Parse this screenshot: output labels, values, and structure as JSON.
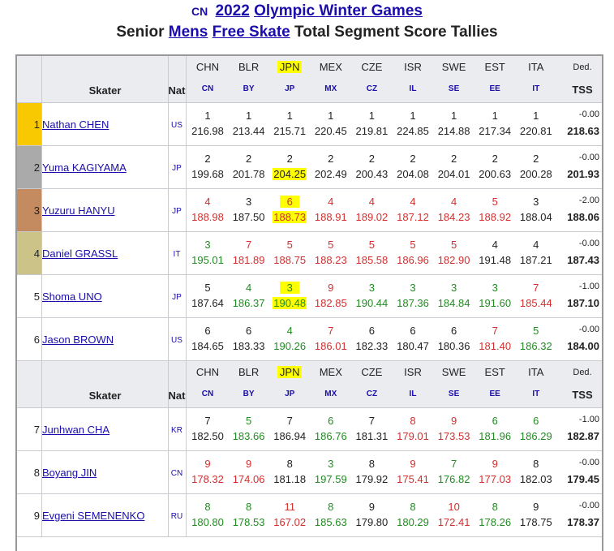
{
  "title": {
    "country_code": "CN",
    "year": "2022",
    "event": "Olympic Winter Games",
    "line2_pre": "Senior",
    "category": "Mens",
    "segment": "Free Skate",
    "line2_post": "Total Segment Score Tallies"
  },
  "header": {
    "skater": "Skater",
    "nat": "Nat",
    "ded": "Ded.",
    "tss": "TSS",
    "judges": [
      {
        "name": "CHN",
        "code": "CN"
      },
      {
        "name": "BLR",
        "code": "BY"
      },
      {
        "name": "JPN",
        "code": "JP"
      },
      {
        "name": "MEX",
        "code": "MX"
      },
      {
        "name": "CZE",
        "code": "CZ"
      },
      {
        "name": "ISR",
        "code": "IL"
      },
      {
        "name": "SWE",
        "code": "SE"
      },
      {
        "name": "EST",
        "code": "EE"
      },
      {
        "name": "ITA",
        "code": "IT"
      }
    ]
  },
  "colors": {
    "gold": "#f8c900",
    "silver": "#aaaaaa",
    "bronze": "#c38b5f",
    "fourth": "#ccc389",
    "green": "#228b22",
    "red": "#d32f2f",
    "highlight": "#ffff00",
    "link": "#1a0dab"
  },
  "rows": [
    {
      "rank": "1",
      "skater": "Nathan CHEN",
      "nat": "US",
      "ded": "-0.00",
      "tss": "218.63",
      "scores": [
        [
          "1",
          "216.98",
          "black"
        ],
        [
          "1",
          "213.44",
          "black"
        ],
        [
          "1",
          "215.71",
          "black"
        ],
        [
          "1",
          "220.45",
          "black"
        ],
        [
          "1",
          "219.81",
          "black"
        ],
        [
          "1",
          "224.85",
          "black"
        ],
        [
          "1",
          "214.88",
          "black"
        ],
        [
          "1",
          "217.34",
          "black"
        ],
        [
          "1",
          "220.81",
          "black"
        ]
      ]
    },
    {
      "rank": "2",
      "skater": "Yuma KAGIYAMA",
      "nat": "JP",
      "ded": "-0.00",
      "tss": "201.93",
      "scores": [
        [
          "2",
          "199.68",
          "black"
        ],
        [
          "2",
          "201.78",
          "black"
        ],
        [
          "2",
          "204.25",
          "black"
        ],
        [
          "2",
          "202.49",
          "black"
        ],
        [
          "2",
          "200.43",
          "black"
        ],
        [
          "2",
          "204.08",
          "black"
        ],
        [
          "2",
          "204.01",
          "black"
        ],
        [
          "2",
          "200.63",
          "black"
        ],
        [
          "2",
          "200.28",
          "black"
        ]
      ]
    },
    {
      "rank": "3",
      "skater": "Yuzuru HANYU",
      "nat": "JP",
      "ded": "-2.00",
      "tss": "188.06",
      "scores": [
        [
          "4",
          "188.98",
          "red"
        ],
        [
          "3",
          "187.50",
          "black"
        ],
        [
          "6",
          "188.73",
          "red"
        ],
        [
          "4",
          "188.91",
          "red"
        ],
        [
          "4",
          "189.02",
          "red"
        ],
        [
          "4",
          "187.12",
          "red"
        ],
        [
          "4",
          "184.23",
          "red"
        ],
        [
          "5",
          "188.92",
          "red"
        ],
        [
          "3",
          "188.04",
          "black"
        ]
      ]
    },
    {
      "rank": "4",
      "skater": "Daniel GRASSL",
      "nat": "IT",
      "ded": "-0.00",
      "tss": "187.43",
      "scores": [
        [
          "3",
          "195.01",
          "green"
        ],
        [
          "7",
          "181.89",
          "red"
        ],
        [
          "5",
          "188.75",
          "red"
        ],
        [
          "5",
          "188.23",
          "red"
        ],
        [
          "5",
          "185.58",
          "red"
        ],
        [
          "5",
          "186.96",
          "red"
        ],
        [
          "5",
          "182.90",
          "red"
        ],
        [
          "4",
          "191.48",
          "black"
        ],
        [
          "4",
          "187.21",
          "black"
        ]
      ]
    },
    {
      "rank": "5",
      "skater": "Shoma UNO",
      "nat": "JP",
      "ded": "-1.00",
      "tss": "187.10",
      "scores": [
        [
          "5",
          "187.64",
          "black"
        ],
        [
          "4",
          "186.37",
          "green"
        ],
        [
          "3",
          "190.48",
          "green"
        ],
        [
          "9",
          "182.85",
          "red"
        ],
        [
          "3",
          "190.44",
          "green"
        ],
        [
          "3",
          "187.36",
          "green"
        ],
        [
          "3",
          "184.84",
          "green"
        ],
        [
          "3",
          "191.60",
          "green"
        ],
        [
          "7",
          "185.44",
          "red"
        ]
      ]
    },
    {
      "rank": "6",
      "skater": "Jason BROWN",
      "nat": "US",
      "ded": "-0.00",
      "tss": "184.00",
      "scores": [
        [
          "6",
          "184.65",
          "black"
        ],
        [
          "6",
          "183.33",
          "black"
        ],
        [
          "4",
          "190.26",
          "green"
        ],
        [
          "7",
          "186.01",
          "red"
        ],
        [
          "6",
          "182.33",
          "black"
        ],
        [
          "6",
          "180.47",
          "black"
        ],
        [
          "6",
          "180.36",
          "black"
        ],
        [
          "7",
          "181.40",
          "red"
        ],
        [
          "5",
          "186.32",
          "green"
        ]
      ]
    },
    {
      "rank": "7",
      "skater": "Junhwan CHA",
      "nat": "KR",
      "ded": "-1.00",
      "tss": "182.87",
      "scores": [
        [
          "7",
          "182.50",
          "black"
        ],
        [
          "5",
          "183.66",
          "green"
        ],
        [
          "7",
          "186.94",
          "black"
        ],
        [
          "6",
          "186.76",
          "green"
        ],
        [
          "7",
          "181.31",
          "black"
        ],
        [
          "8",
          "179.01",
          "red"
        ],
        [
          "9",
          "173.53",
          "red"
        ],
        [
          "6",
          "181.96",
          "green"
        ],
        [
          "6",
          "186.29",
          "green"
        ]
      ]
    },
    {
      "rank": "8",
      "skater": "Boyang JIN",
      "nat": "CN",
      "ded": "-0.00",
      "tss": "179.45",
      "scores": [
        [
          "9",
          "178.32",
          "red"
        ],
        [
          "9",
          "174.06",
          "red"
        ],
        [
          "8",
          "181.18",
          "black"
        ],
        [
          "3",
          "197.59",
          "green"
        ],
        [
          "8",
          "179.92",
          "black"
        ],
        [
          "9",
          "175.41",
          "red"
        ],
        [
          "7",
          "176.82",
          "green"
        ],
        [
          "9",
          "177.03",
          "red"
        ],
        [
          "8",
          "182.03",
          "black"
        ]
      ]
    },
    {
      "rank": "9",
      "skater": "Evgeni SEMENENKO",
      "nat": "RU",
      "ded": "-0.00",
      "tss": "178.37",
      "scores": [
        [
          "8",
          "180.80",
          "green"
        ],
        [
          "8",
          "178.53",
          "green"
        ],
        [
          "11",
          "167.02",
          "red"
        ],
        [
          "8",
          "185.63",
          "green"
        ],
        [
          "9",
          "179.80",
          "black"
        ],
        [
          "8",
          "180.29",
          "green"
        ],
        [
          "10",
          "172.41",
          "red"
        ],
        [
          "8",
          "178.26",
          "green"
        ],
        [
          "9",
          "178.75",
          "black"
        ]
      ]
    }
  ]
}
